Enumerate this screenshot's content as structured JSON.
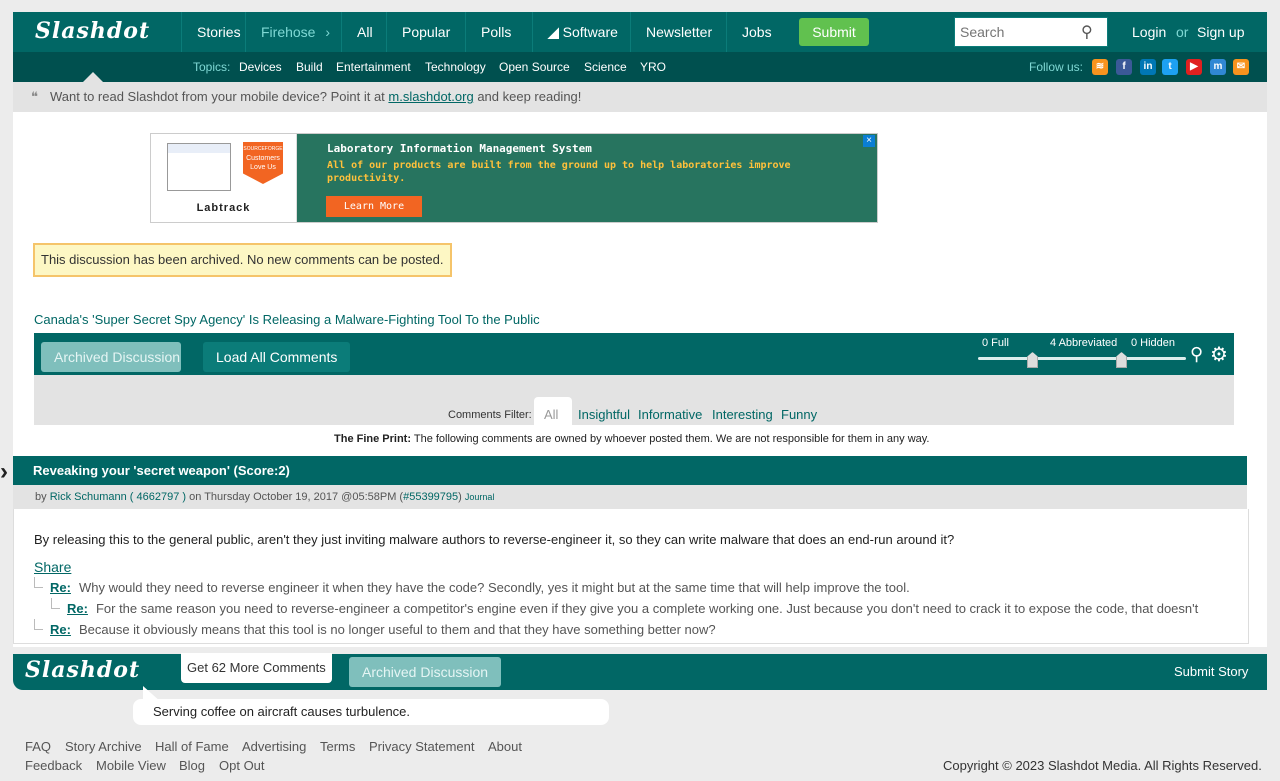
{
  "header": {
    "logo": "Slashdot",
    "nav": [
      "Stories",
      "Firehose",
      "All",
      "Popular",
      "Polls",
      "Software",
      "Newsletter",
      "Jobs"
    ],
    "submit_label": "Submit",
    "search_placeholder": "Search",
    "login_label": "Login",
    "or_label": "or",
    "signup_label": "Sign up"
  },
  "topics": {
    "label": "Topics:",
    "items": [
      "Devices",
      "Build",
      "Entertainment",
      "Technology",
      "Open Source",
      "Science",
      "YRO"
    ],
    "follow_label": "Follow us:"
  },
  "mobile_banner": {
    "text": "Want to read Slashdot from your mobile device? Point it at",
    "link": "m.slashdot.org",
    "suffix": "and keep reading!"
  },
  "ad": {
    "title": "Laboratory Information Management System",
    "body": "All of our products are built from the ground up to help laboratories improve productivity.",
    "cta": "Learn More",
    "brand": "Labtrack",
    "badge_top": "SOURCEFORGE",
    "badge_main": "Customers Love Us"
  },
  "archived_notice": "This discussion has been archived. No new comments can be posted.",
  "story_link": "Canada's 'Super Secret Spy Agency' Is Releasing a Malware-Fighting Tool To the Public",
  "comment_controls": {
    "archived_label": "Archived Discussion",
    "load_all_label": "Load All Comments",
    "full_label": "0 Full",
    "abbrev_label": "4 Abbreviated",
    "hidden_label": "0 Hidden"
  },
  "filter": {
    "label": "Comments Filter:",
    "tabs": [
      "All",
      "Insightful",
      "Informative",
      "Interesting",
      "Funny"
    ]
  },
  "fine_print": {
    "label": "The Fine Print:",
    "text": "The following comments are owned by whoever posted them. We are not responsible for them in any way."
  },
  "comment": {
    "title": "Reveaking your 'secret weapon' (Score:2)",
    "by": "by",
    "author": "Rick Schumann ( 4662797 )",
    "date": "on Thursday October 19, 2017 @05:58PM (",
    "id": "#55399795",
    "close_paren": ")",
    "journal": "Journal",
    "body": "By releasing this to the general public, aren't they just inviting malware authors to reverse-engineer it, so they can write malware that does an end-run around it?",
    "share": "Share",
    "replies": [
      {
        "label": "Re:",
        "text": "Why would they need to reverse engineer it when they have the code? Secondly, yes it might but at the same time that will help improve the tool."
      },
      {
        "label": "Re:",
        "text": "For the same reason you need to reverse-engineer a competitor's engine even if they give you a complete working one. Just because you don't need to crack it to expose the code, that doesn't"
      },
      {
        "label": "Re:",
        "text": "Because it obviously means that this tool is no longer useful to them and that they have something better now?"
      }
    ]
  },
  "footer": {
    "logo": "Slashdot",
    "more_comments": "Get 62 More Comments",
    "archived_label": "Archived Discussion",
    "submit_story": "Submit Story",
    "quote": "Serving coffee on aircraft causes turbulence.",
    "links_row1": [
      "FAQ",
      "Story Archive",
      "Hall of Fame",
      "Advertising",
      "Terms",
      "Privacy Statement",
      "About"
    ],
    "links_row2": [
      "Feedback",
      "Mobile View",
      "Blog",
      "Opt Out"
    ],
    "copyright": "Copyright © 2023 Slashdot Media. All Rights Reserved."
  },
  "colors": {
    "brand": "#016765",
    "brand_dark": "#00504f",
    "submit_green": "#61c14f",
    "notice_border": "#f5c46a"
  }
}
